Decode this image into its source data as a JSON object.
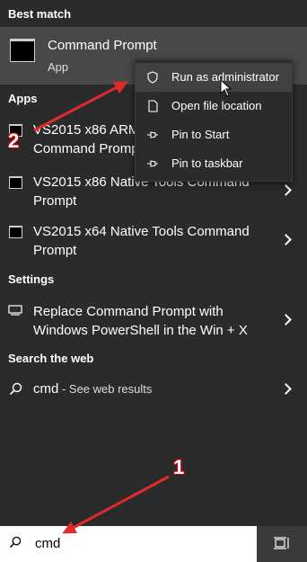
{
  "sections": {
    "best_match": "Best match",
    "apps": "Apps",
    "settings": "Settings",
    "web": "Search the web"
  },
  "best_match": {
    "title": "Command Prompt",
    "subtitle": "App"
  },
  "apps": [
    {
      "line1": "VS2015 x86 ARM",
      "line2": "Command Prompt"
    },
    {
      "line1": "VS2015 x86 Native Tools Command",
      "line2": "Prompt"
    },
    {
      "line1": "VS2015 x64 Native Tools Command",
      "line2": "Prompt"
    }
  ],
  "settings_item": {
    "line1": "Replace Command Prompt with",
    "line2": "Windows PowerShell in the Win + X"
  },
  "web_item": {
    "query": "cmd",
    "suffix": " - See web results"
  },
  "context_menu": [
    {
      "label": "Run as administrator",
      "icon": "shield-icon"
    },
    {
      "label": "Open file location",
      "icon": "file-icon"
    },
    {
      "label": "Pin to Start",
      "icon": "pin-icon"
    },
    {
      "label": "Pin to taskbar",
      "icon": "pin-icon"
    }
  ],
  "search": {
    "value": "cmd"
  },
  "annotations": {
    "step1": "1",
    "step2": "2",
    "arrow_color": "#e02b2b"
  }
}
